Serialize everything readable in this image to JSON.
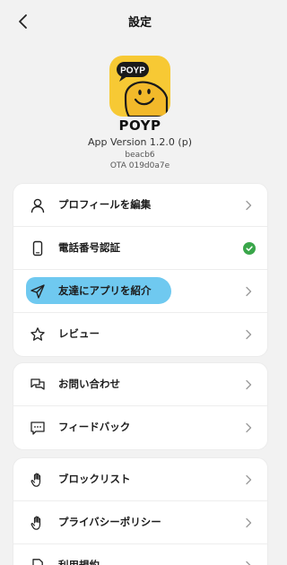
{
  "header": {
    "title": "設定"
  },
  "app": {
    "icon_text": "POYP",
    "name": "POYP",
    "version": "App Version 1.2.0 (p)",
    "build": "beacb6",
    "ota": "OTA 019d0a7e"
  },
  "colors": {
    "accent_yellow": "#f7c934",
    "check_green": "#3aa64a",
    "highlight_blue": "#5fc3ee"
  },
  "sections": [
    {
      "items": [
        {
          "label": "プロフィールを編集",
          "icon": "person-icon",
          "trailing": "chevron"
        },
        {
          "label": "電話番号認証",
          "icon": "phone-icon",
          "trailing": "check"
        },
        {
          "label": "友達にアプリを紹介",
          "icon": "send-icon",
          "trailing": "chevron",
          "highlighted": true
        },
        {
          "label": "レビュー",
          "icon": "star-icon",
          "trailing": "chevron"
        }
      ]
    },
    {
      "items": [
        {
          "label": "お問い合わせ",
          "icon": "chat-icon",
          "trailing": "chevron"
        },
        {
          "label": "フィードバック",
          "icon": "feedback-icon",
          "trailing": "chevron"
        }
      ]
    },
    {
      "items": [
        {
          "label": "ブロックリスト",
          "icon": "hand-icon",
          "trailing": "chevron"
        },
        {
          "label": "プライバシーポリシー",
          "icon": "hand-icon",
          "trailing": "chevron"
        },
        {
          "label": "利用規約",
          "icon": "document-icon",
          "trailing": "chevron"
        }
      ]
    }
  ]
}
